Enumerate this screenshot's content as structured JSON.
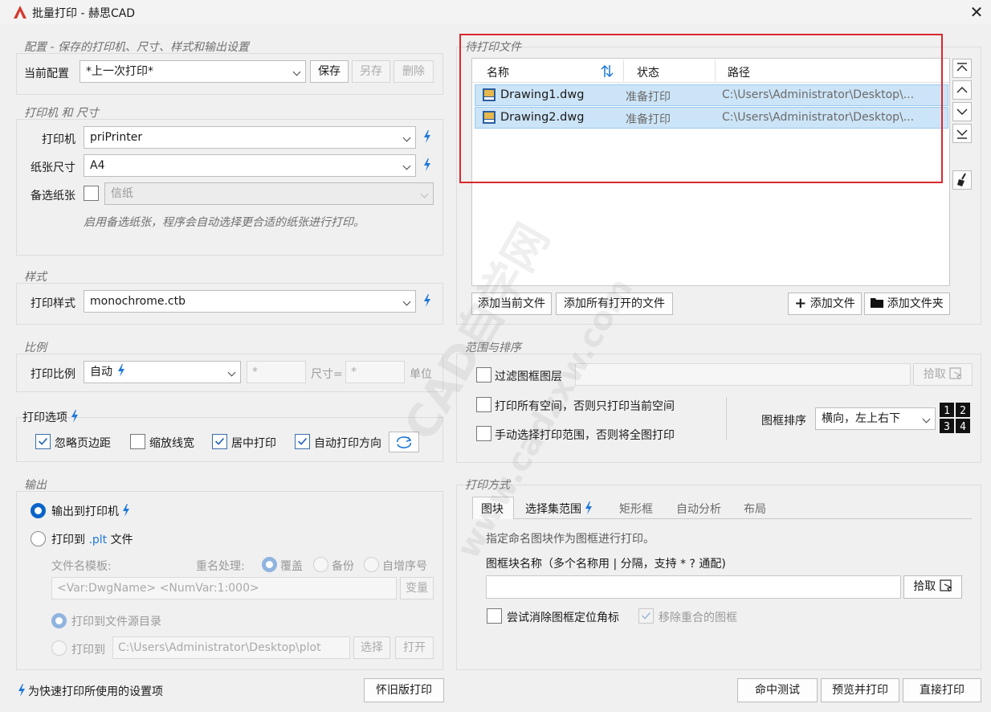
{
  "window": {
    "title": "批量打印 - 赫思CAD",
    "close": "✕"
  },
  "config": {
    "group_label": "配置 - 保存的打印机、尺寸、样式和输出设置",
    "current_label": "当前配置",
    "current_value": "*上一次打印*",
    "save": "保存",
    "save_as": "另存",
    "delete": "删除"
  },
  "printer": {
    "group_label": "打印机 和 尺寸",
    "printer_label": "打印机",
    "printer_value": "priPrinter",
    "paper_label": "纸张尺寸",
    "paper_value": "A4",
    "alt_paper_label": "备选纸张",
    "alt_paper_value": "信纸",
    "hint": "启用备选纸张，程序会自动选择更合适的纸张进行打印。"
  },
  "style": {
    "group_label": "样式",
    "label": "打印样式",
    "value": "monochrome.ctb"
  },
  "scale": {
    "group_label": "比例",
    "label": "打印比例",
    "value": "自动",
    "field1": "*",
    "size_label": "尺寸=",
    "field2": "*",
    "unit_label": "单位"
  },
  "options": {
    "group_label": "打印选项",
    "ignore_margin": "忽略页边距",
    "scale_lineweight": "缩放线宽",
    "center": "居中打印",
    "auto_orientation": "自动打印方向"
  },
  "output": {
    "group_label": "输出",
    "to_printer": "输出到打印机",
    "to_plt_prefix": "打印到 ",
    "to_plt_ext": ".plt",
    "to_plt_suffix": " 文件",
    "template_label": "文件名模板:",
    "rename_label": "重名处理:",
    "rename_overwrite": "覆盖",
    "rename_backup": "备份",
    "rename_increment": "自增序号",
    "template_value": "<Var:DwgName> <NumVar:1:000>",
    "variable_btn": "变量",
    "to_source_dir": "打印到文件源目录",
    "to_dir_label": "打印到",
    "dir_value": "C:\\Users\\Administrator\\Desktop\\plot",
    "select_btn": "选择",
    "open_btn": "打开"
  },
  "footer": {
    "quick_hint": "为快速打印所使用的设置项",
    "legacy": "怀旧版打印",
    "hit_test": "命中测试",
    "preview_print": "预览并打印",
    "direct_print": "直接打印"
  },
  "files": {
    "group_label": "待打印文件",
    "columns": {
      "name": "名称",
      "status": "状态",
      "path": "路径"
    },
    "rows": [
      {
        "name": "Drawing1.dwg",
        "status": "准备打印",
        "path": "C:\\Users\\Administrator\\Desktop\\..."
      },
      {
        "name": "Drawing2.dwg",
        "status": "准备打印",
        "path": "C:\\Users\\Administrator\\Desktop\\..."
      }
    ],
    "add_current": "添加当前文件",
    "add_all_open": "添加所有打开的文件",
    "add_file": "添加文件",
    "add_folder": "添加文件夹"
  },
  "range": {
    "group_label": "范围与排序",
    "filter_layers": "过滤图框图层",
    "pick_btn": "拾取",
    "all_spaces": "打印所有空间，否则只打印当前空间",
    "manual_range": "手动选择打印范围，否则将全图打印",
    "order_label": "图框排序",
    "order_value": "横向，左上右下",
    "order_icon_text": [
      "1",
      "2",
      "3",
      "4"
    ]
  },
  "method": {
    "group_label": "打印方式",
    "tabs": [
      "图块",
      "选择集范围",
      "矩形框",
      "自动分析",
      "布局"
    ],
    "description": "指定命名图块作为图框进行打印。",
    "block_name_label": "图框块名称（多个名称用 | 分隔，支持 * ? 通配)",
    "block_name_value": "",
    "pick_btn": "拾取",
    "erase_anchor": "尝试消除图框定位角标",
    "remove_overlap": "移除重合的图框"
  },
  "watermark": {
    "line1": "CAD自学网",
    "line2": "www.cadzxw.com"
  },
  "colors": {
    "accent": "#0a64c8",
    "selection": "#cce4f7",
    "highlight_box": "#d9282f",
    "bolt": "#1e78d7"
  }
}
